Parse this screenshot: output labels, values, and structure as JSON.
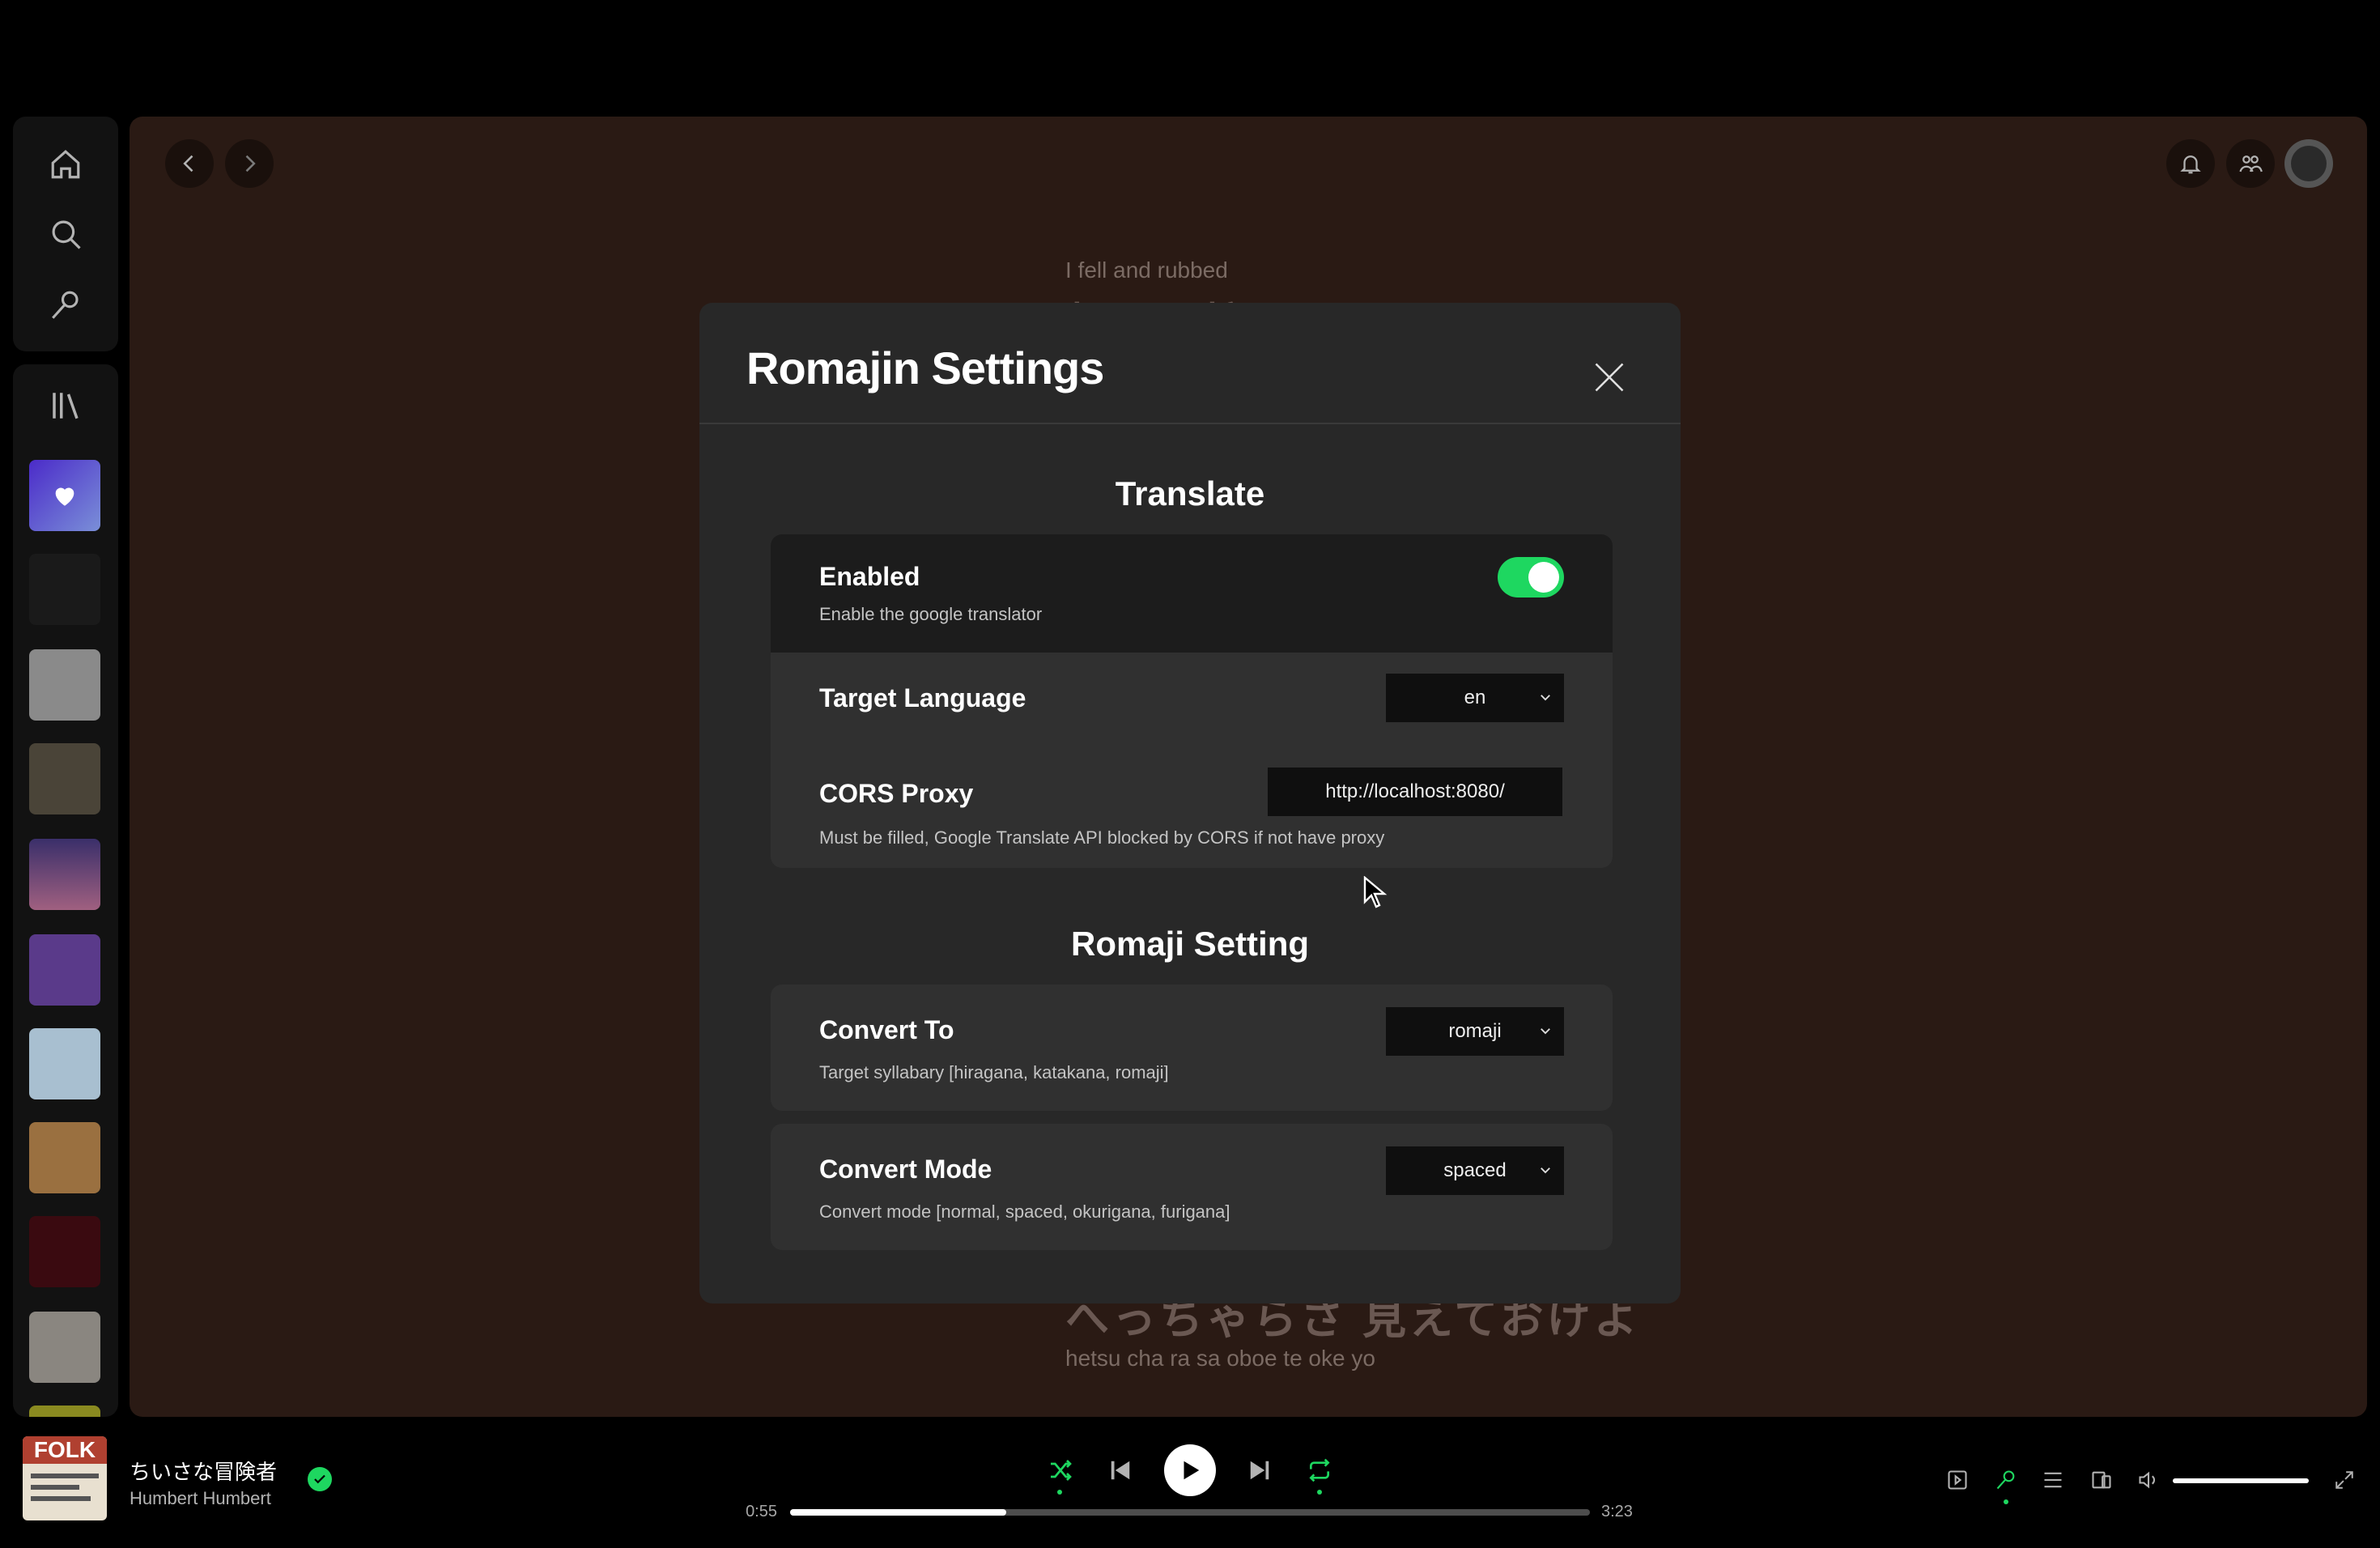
{
  "main": {
    "lyrics_top_en": "I fell and rubbed",
    "lyrics_top_jp": "転んで擦りむいたとこ",
    "lyrics_bottom_jp": "へっちゃらさ 見えておけよ",
    "lyrics_bottom_en": "hetsu cha ra sa oboe te oke yo"
  },
  "dialog": {
    "title": "Romajin Settings",
    "translate": {
      "heading": "Translate",
      "enabled_label": "Enabled",
      "enabled_desc": "Enable the google translator",
      "enabled_on": true,
      "target_label": "Target Language",
      "target_value": "en",
      "cors_label": "CORS Proxy",
      "cors_value": "http://localhost:8080/",
      "cors_desc": "Must be filled, Google Translate API blocked by CORS if not have proxy"
    },
    "romaji": {
      "heading": "Romaji Setting",
      "convert_to_label": "Convert To",
      "convert_to_value": "romaji",
      "convert_to_desc": "Target syllabary [hiragana, katakana, romaji]",
      "convert_mode_label": "Convert Mode",
      "convert_mode_value": "spaced",
      "convert_mode_desc": "Convert mode [normal, spaced, okurigana, furigana]"
    }
  },
  "player": {
    "album_art_text": "FOLK",
    "track_title": "ちいさな冒険者",
    "artist": "Humbert Humbert",
    "elapsed": "0:55",
    "duration": "3:23",
    "progress": 0.27,
    "volume": 1.0
  },
  "colors": {
    "accent": "#1ed760",
    "main_bg": "#2a1a14",
    "dialog_bg": "#282828"
  }
}
